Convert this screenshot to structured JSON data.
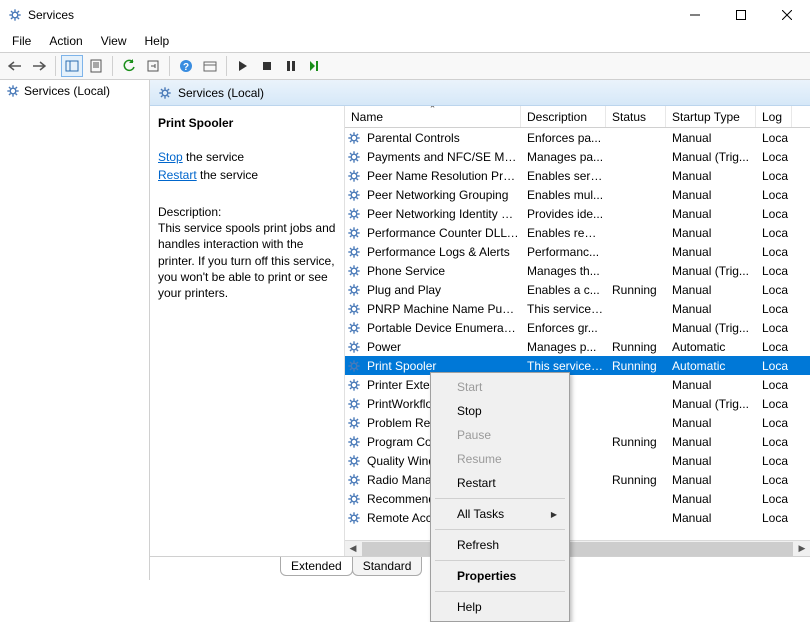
{
  "window": {
    "title": "Services"
  },
  "menu": {
    "file": "File",
    "action": "Action",
    "view": "View",
    "help": "Help"
  },
  "sidebar": {
    "root": "Services (Local)"
  },
  "header": {
    "title": "Services (Local)"
  },
  "detail": {
    "name": "Print Spooler",
    "stop_pre": "Stop",
    "stop_post": " the service",
    "restart_pre": "Restart",
    "restart_post": " the service",
    "desc_label": "Description:",
    "desc_text": "This service spools print jobs and handles interaction with the printer. If you turn off this service, you won't be able to print or see your printers."
  },
  "columns": {
    "name": "Name",
    "desc": "Description",
    "status": "Status",
    "startup": "Startup Type",
    "logon": "Log"
  },
  "rows": [
    {
      "name": "Parental Controls",
      "desc": "Enforces pa...",
      "status": "",
      "startup": "Manual",
      "logon": "Loca",
      "sel": false
    },
    {
      "name": "Payments and NFC/SE Man...",
      "desc": "Manages pa...",
      "status": "",
      "startup": "Manual (Trig...",
      "logon": "Loca",
      "sel": false
    },
    {
      "name": "Peer Name Resolution Prot...",
      "desc": "Enables serv...",
      "status": "",
      "startup": "Manual",
      "logon": "Loca",
      "sel": false
    },
    {
      "name": "Peer Networking Grouping",
      "desc": "Enables mul...",
      "status": "",
      "startup": "Manual",
      "logon": "Loca",
      "sel": false
    },
    {
      "name": "Peer Networking Identity M...",
      "desc": "Provides ide...",
      "status": "",
      "startup": "Manual",
      "logon": "Loca",
      "sel": false
    },
    {
      "name": "Performance Counter DLL ...",
      "desc": "Enables rem...",
      "status": "",
      "startup": "Manual",
      "logon": "Loca",
      "sel": false
    },
    {
      "name": "Performance Logs & Alerts",
      "desc": "Performanc...",
      "status": "",
      "startup": "Manual",
      "logon": "Loca",
      "sel": false
    },
    {
      "name": "Phone Service",
      "desc": "Manages th...",
      "status": "",
      "startup": "Manual (Trig...",
      "logon": "Loca",
      "sel": false
    },
    {
      "name": "Plug and Play",
      "desc": "Enables a c...",
      "status": "Running",
      "startup": "Manual",
      "logon": "Loca",
      "sel": false
    },
    {
      "name": "PNRP Machine Name Publi...",
      "desc": "This service ...",
      "status": "",
      "startup": "Manual",
      "logon": "Loca",
      "sel": false
    },
    {
      "name": "Portable Device Enumerator...",
      "desc": "Enforces gr...",
      "status": "",
      "startup": "Manual (Trig...",
      "logon": "Loca",
      "sel": false
    },
    {
      "name": "Power",
      "desc": "Manages p...",
      "status": "Running",
      "startup": "Automatic",
      "logon": "Loca",
      "sel": false
    },
    {
      "name": "Print Spooler",
      "desc": "This service ...",
      "status": "Running",
      "startup": "Automatic",
      "logon": "Loca",
      "sel": true
    },
    {
      "name": "Printer Exten",
      "desc": "ce ...",
      "status": "",
      "startup": "Manual",
      "logon": "Loca",
      "sel": false
    },
    {
      "name": "PrintWorkflo",
      "desc": "ce ...",
      "status": "",
      "startup": "Manual (Trig...",
      "logon": "Loca",
      "sel": false
    },
    {
      "name": "Problem Rep",
      "desc": "ce ...",
      "status": "",
      "startup": "Manual",
      "logon": "Loca",
      "sel": false
    },
    {
      "name": "Program Co",
      "desc": "ce ...",
      "status": "Running",
      "startup": "Manual",
      "logon": "Loca",
      "sel": false
    },
    {
      "name": "Quality Wind",
      "desc": "/in...",
      "status": "",
      "startup": "Manual",
      "logon": "Loca",
      "sel": false
    },
    {
      "name": "Radio Manag",
      "desc": "na...",
      "status": "Running",
      "startup": "Manual",
      "logon": "Loca",
      "sel": false
    },
    {
      "name": "Recommend",
      "desc": "co...",
      "status": "",
      "startup": "Manual",
      "logon": "Loca",
      "sel": false
    },
    {
      "name": "Remote Acc",
      "desc": "co...",
      "status": "",
      "startup": "Manual",
      "logon": "Loca",
      "sel": false
    }
  ],
  "context": {
    "start": "Start",
    "stop": "Stop",
    "pause": "Pause",
    "resume": "Resume",
    "restart": "Restart",
    "alltasks": "All Tasks",
    "refresh": "Refresh",
    "properties": "Properties",
    "help": "Help"
  },
  "tabs": {
    "extended": "Extended",
    "standard": "Standard"
  }
}
